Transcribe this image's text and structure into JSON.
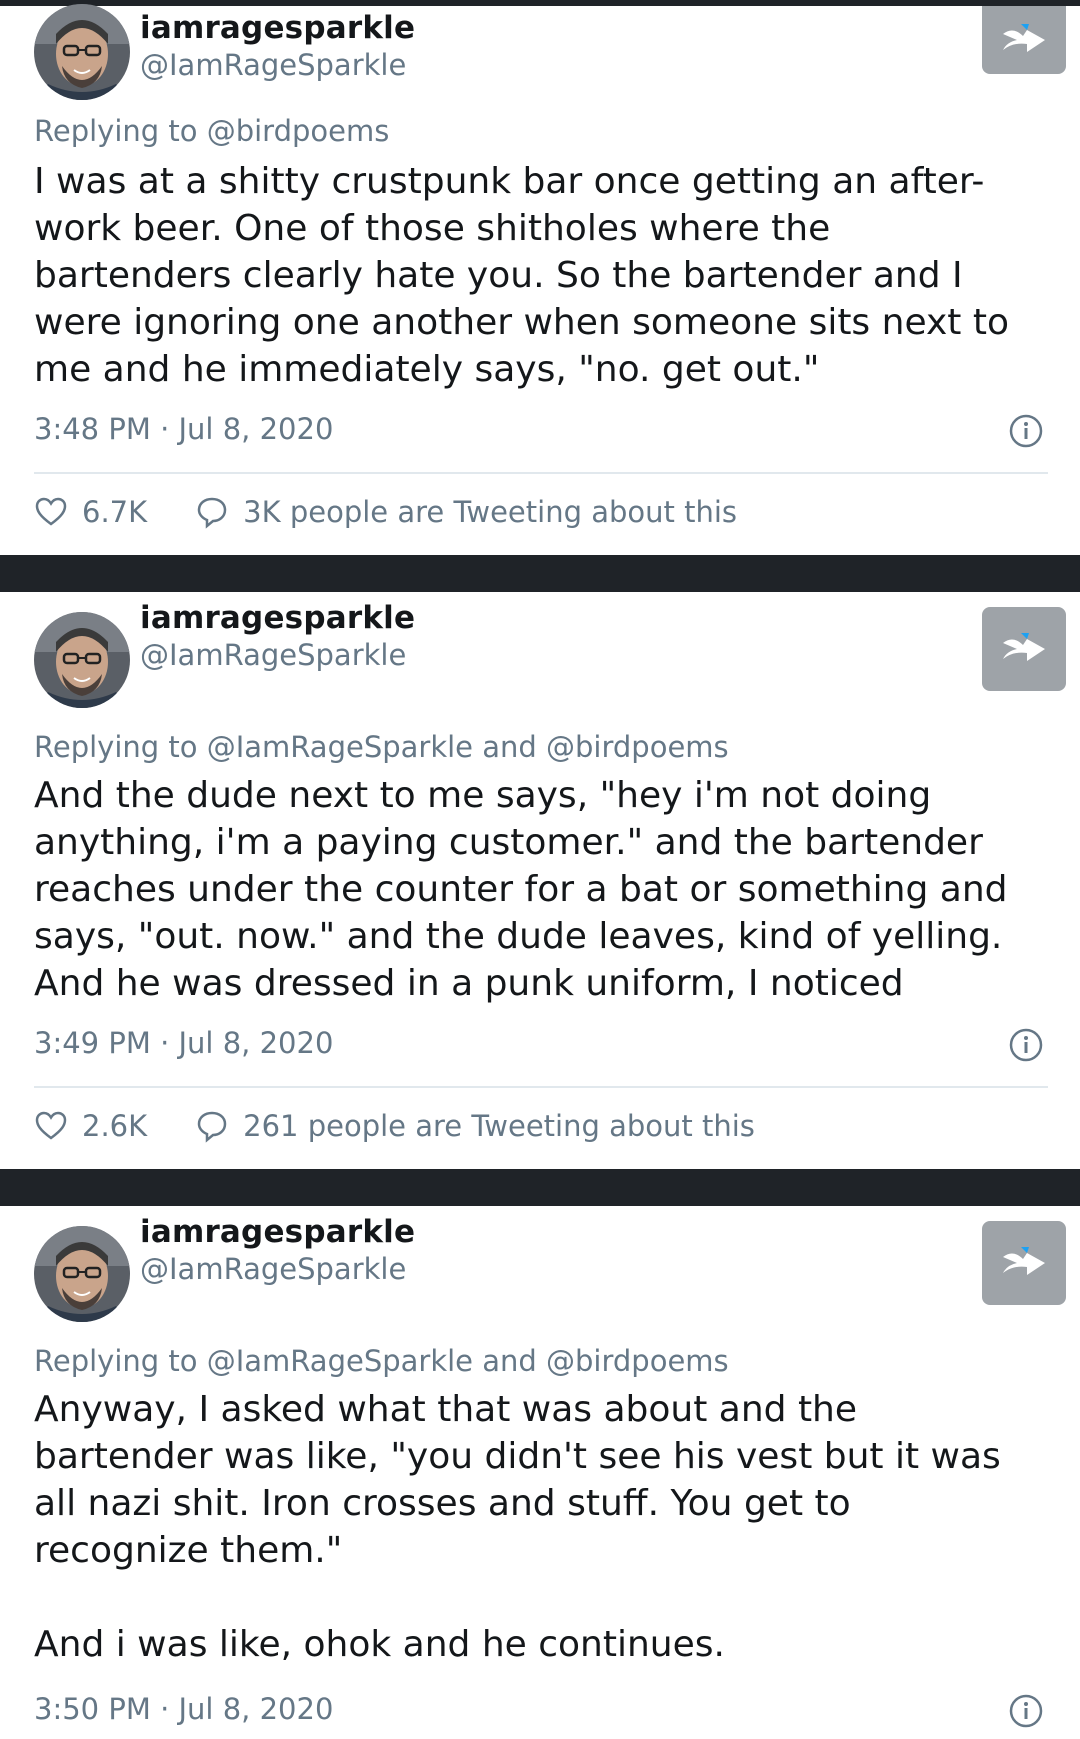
{
  "tweets": [
    {
      "display_name": "iamragesparkle",
      "handle": "@IamRageSparkle",
      "replying_to": "Replying to @birdpoems",
      "text": "I was at a shitty crustpunk bar once getting an after-\nwork beer. One of those shitholes where the\nbartenders clearly hate you. So the bartender and I\nwere ignoring one another when someone sits next to\nme and he immediately says, \"no. get out.\"",
      "timestamp": "3:48 PM · Jul 8, 2020",
      "likes": "6.7K",
      "tweeting_about": "3K people are Tweeting about this"
    },
    {
      "display_name": "iamragesparkle",
      "handle": "@IamRageSparkle",
      "replying_to": "Replying to @IamRageSparkle and @birdpoems",
      "text": "And the dude next to me says, \"hey i'm not doing\nanything, i'm a paying customer.\" and the bartender\nreaches under the counter for a bat or something and\nsays, \"out. now.\" and the dude leaves, kind of yelling.\nAnd he was dressed in a punk uniform, I noticed",
      "timestamp": "3:49 PM · Jul 8, 2020",
      "likes": "2.6K",
      "tweeting_about": "261 people are Tweeting about this"
    },
    {
      "display_name": "iamragesparkle",
      "handle": "@IamRageSparkle",
      "replying_to": "Replying to @IamRageSparkle and @birdpoems",
      "text": "Anyway, I asked what that was about and the\nbartender was like, \"you didn't see his vest but it was\nall nazi shit. Iron crosses and stuff. You get to\nrecognize them.\"\n\nAnd i was like, ohok and he continues.",
      "timestamp": "3:50 PM · Jul 8, 2020"
    }
  ],
  "icons": {
    "share": "share-arrow-icon",
    "info": "info-icon",
    "like": "heart-icon",
    "reply": "speech-bubble-icon"
  },
  "colors": {
    "background": "#1f2328",
    "card": "#ffffff",
    "text": "#14171a",
    "secondary": "#657786",
    "divider": "#e1e8ed",
    "share_button": "#9ea3a8"
  }
}
